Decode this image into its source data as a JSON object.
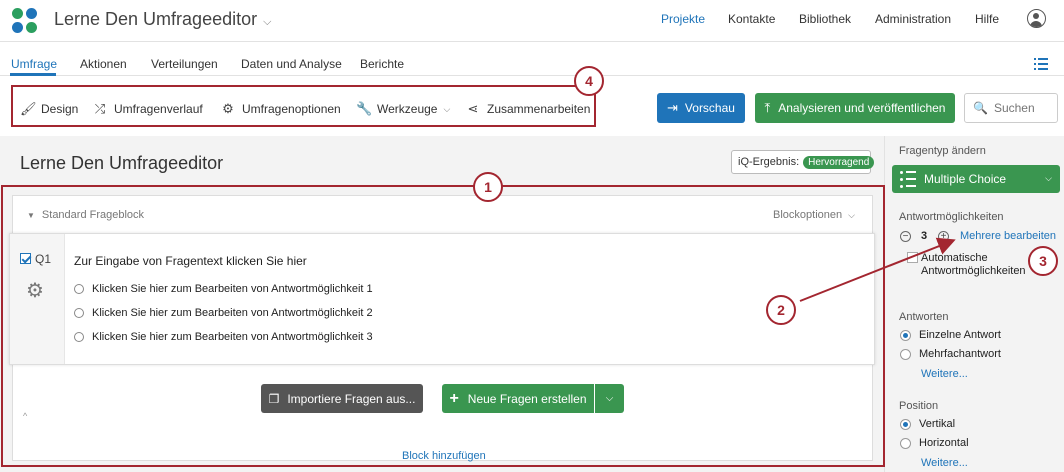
{
  "header": {
    "title": "Lerne Den Umfrageeditor",
    "nav": [
      "Projekte",
      "Kontakte",
      "Bibliothek",
      "Administration",
      "Hilfe"
    ],
    "active_nav": "Projekte"
  },
  "tabs": [
    "Umfrage",
    "Aktionen",
    "Verteilungen",
    "Daten und Analyse",
    "Berichte"
  ],
  "toolbar": {
    "design": "Design",
    "history": "Umfragenverlauf",
    "options": "Umfragenoptionen",
    "tools": "Werkzeuge",
    "collaborate": "Zusammenarbeiten",
    "preview": "Vorschau",
    "publish": "Analysieren und veröffentlichen",
    "search_placeholder": "Suchen"
  },
  "survey": {
    "title": "Lerne Den Umfrageeditor",
    "iq_label": "iQ-Ergebnis:",
    "iq_value": "Hervorragend"
  },
  "block": {
    "title": "Standard Frageblock",
    "options": "Blockoptionen"
  },
  "question": {
    "id": "Q1",
    "text": "Zur Eingabe von Fragentext klicken Sie hier",
    "choices": [
      "Klicken Sie hier zum Bearbeiten von Antwortmöglichkeit 1",
      "Klicken Sie hier zum Bearbeiten von Antwortmöglichkeit 2",
      "Klicken Sie hier zum Bearbeiten von Antwortmöglichkeit 3"
    ]
  },
  "actions": {
    "import": "Importiere Fragen aus...",
    "create": "Neue Fragen erstellen",
    "add_block": "Block hinzufügen"
  },
  "panel": {
    "change_type": "Fragentyp ändern",
    "type": "Multiple Choice",
    "choices_label": "Antwortmöglichkeiten",
    "choices_count": "3",
    "edit_multiple": "Mehrere bearbeiten",
    "auto_choices": "Automatische Antwortmöglichkeiten",
    "answers_label": "Antworten",
    "single": "Einzelne Antwort",
    "multiple": "Mehrfachantwort",
    "more": "Weitere...",
    "position_label": "Position",
    "vertical": "Vertikal",
    "horizontal": "Horizontal",
    "more2": "Weitere..."
  },
  "annotations": [
    "1",
    "2",
    "3",
    "4"
  ],
  "colors": {
    "primary": "#1f74b9",
    "green": "#3a9650",
    "annotation": "#a32630"
  }
}
